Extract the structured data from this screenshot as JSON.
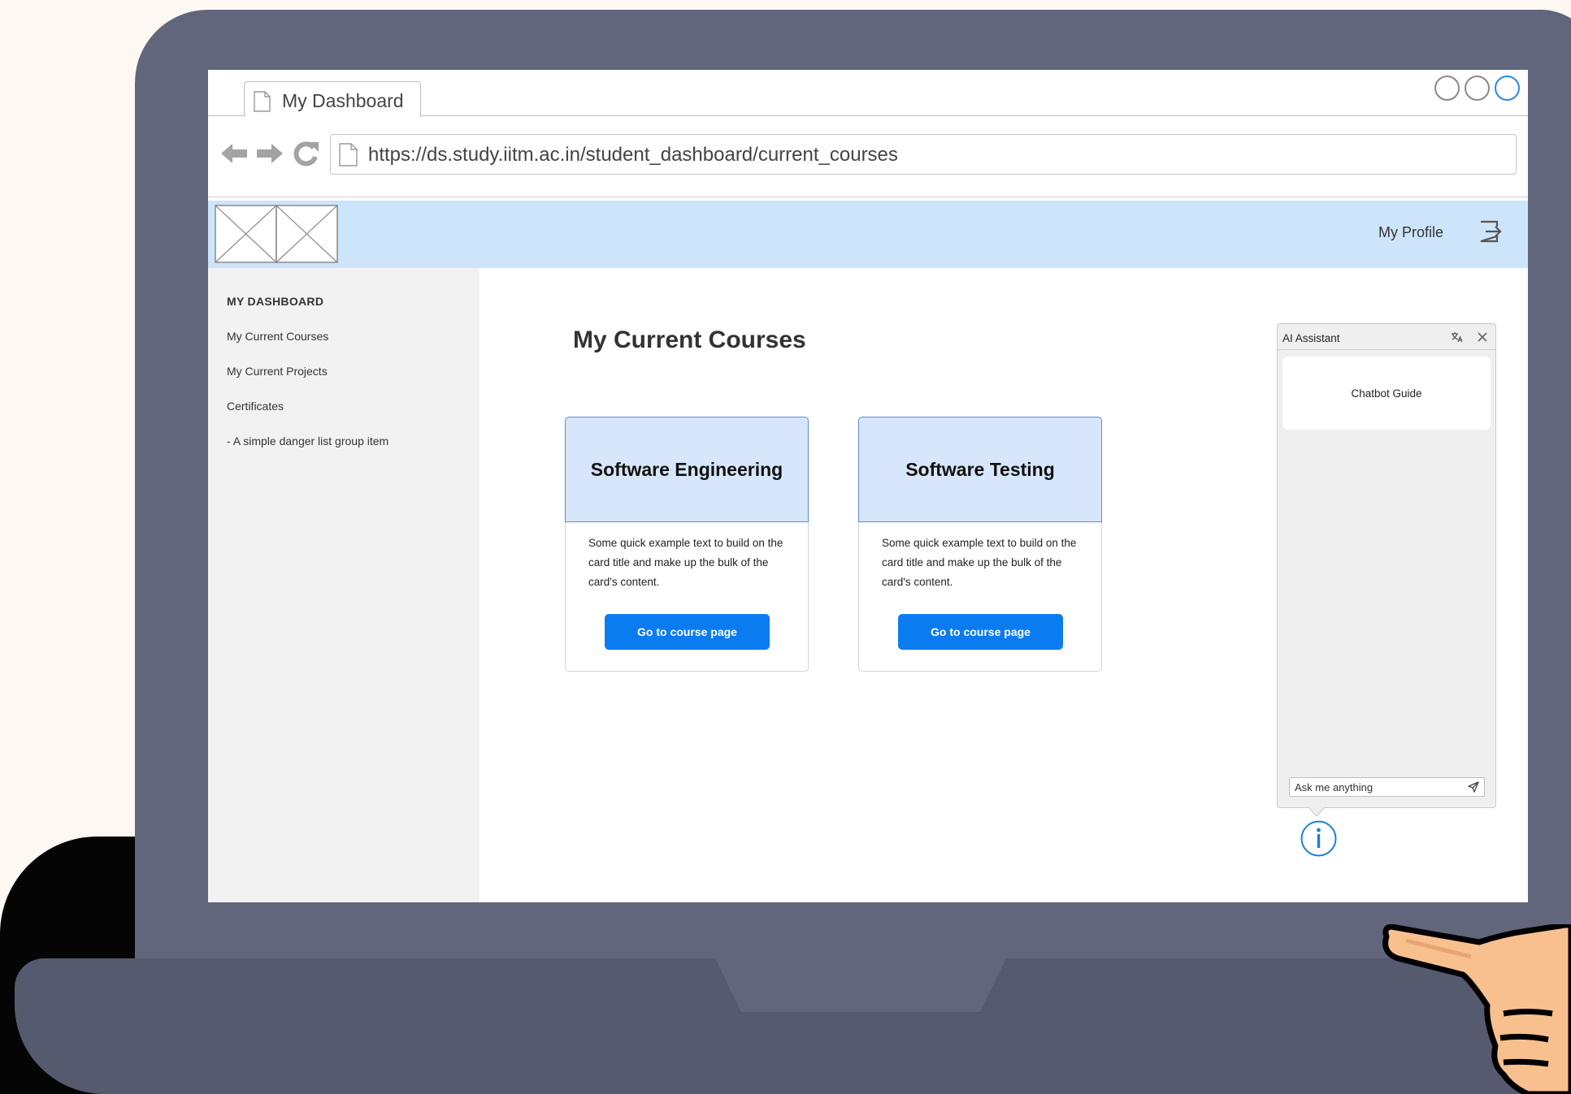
{
  "browser": {
    "tab_title": "My Dashboard",
    "url": "https://ds.study.iitm.ac.in/student_dashboard/current_courses"
  },
  "header": {
    "profile_label": "My Profile",
    "logout_icon": "logout-icon",
    "background_color": "#cde5fb"
  },
  "sidebar": {
    "heading": "MY DASHBOARD",
    "items": [
      {
        "label": "My Current Courses"
      },
      {
        "label": "My Current Projects"
      },
      {
        "label": "Certificates"
      },
      {
        "label": "- A simple danger list group item"
      }
    ]
  },
  "main": {
    "title": "My Current Courses",
    "cards": [
      {
        "title": "Software Engineering",
        "text": "Some quick example text to build on the card title and make up the bulk of the card's content.",
        "button_label": "Go to course page"
      },
      {
        "title": "Software Testing",
        "text": "Some quick example text to build on the card title and make up the bulk of the card's content.",
        "button_label": "Go to course page"
      }
    ],
    "accent_color": "#0a7cf0"
  },
  "chat": {
    "title": "AI Assistant",
    "guide_text": "Chatbot Guide",
    "input_placeholder": "Ask me anything",
    "info_icon": "info-icon"
  }
}
